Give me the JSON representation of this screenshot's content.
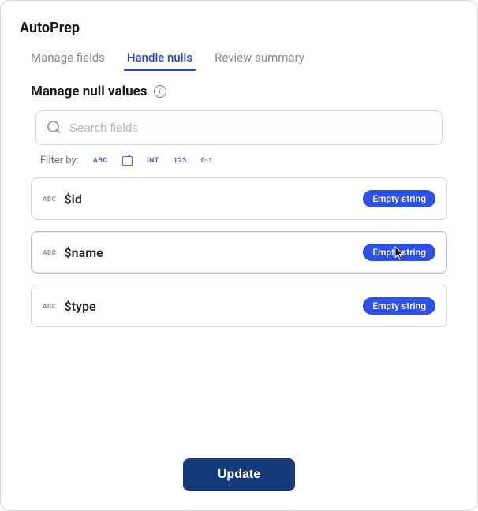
{
  "app": {
    "title": "AutoPrep"
  },
  "tabs": [
    {
      "label": "Manage fields",
      "active": false
    },
    {
      "label": "Handle nulls",
      "active": true
    },
    {
      "label": "Review summary",
      "active": false
    }
  ],
  "section": {
    "title": "Manage null values"
  },
  "search": {
    "placeholder": "Search fields",
    "value": ""
  },
  "filter": {
    "label": "Filter by:",
    "chips": [
      "ABC",
      "DATE",
      "INT",
      "123",
      "0-1"
    ]
  },
  "fields": [
    {
      "type_label": "ABC",
      "name": "$id",
      "action": "Empty string"
    },
    {
      "type_label": "ABC",
      "name": "$name",
      "action": "Empty string",
      "hover": true
    },
    {
      "type_label": "ABC",
      "name": "$type",
      "action": "Empty string"
    }
  ],
  "footer": {
    "update_label": "Update"
  }
}
